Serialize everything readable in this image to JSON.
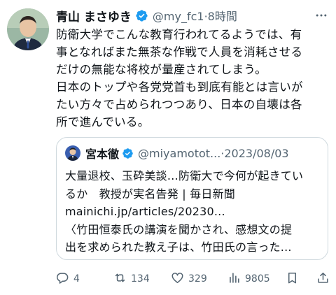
{
  "tweet": {
    "author_name": "青山 まさゆき",
    "handle_time": "@my_fc1·8時間",
    "text": "防衛大学でこんな教育行われてるようでは、有\n事となればまた無茶な作戦で人員を消耗させる\nだけの無能な将校が量産されてしまう。\n日本のトップや各党党首も到底有能とは言いが\nたい方々で占められつつあり、日本の自壊は各\n所で進んでいる。"
  },
  "quote": {
    "author_name": "宮本徹",
    "handle_date": "@miyamotot...·2023/08/03",
    "text": "大量退校、玉砕美談…防衛大で今何が起きてい\nるか　教授が実名告発 | 毎日新聞\nmainichi.jp/articles/20230...\n〈竹田恒泰氏の講演を聞かされ、感想文の提\n出を求められた教え子は、竹田氏の言った..."
  },
  "actions": {
    "replies": "4",
    "retweets": "134",
    "likes": "329",
    "views": "9805"
  },
  "icons": {
    "verified": "verified-badge-icon",
    "more": "more-horizontal-icon",
    "reply": "reply-icon",
    "retweet": "retweet-icon",
    "like": "heart-icon",
    "views": "views-chart-icon",
    "share": "share-icon"
  },
  "colors": {
    "verified_blue": "#1d9bf0",
    "text_primary": "#0f1419",
    "text_secondary": "#536471",
    "border": "#cfd9de"
  }
}
